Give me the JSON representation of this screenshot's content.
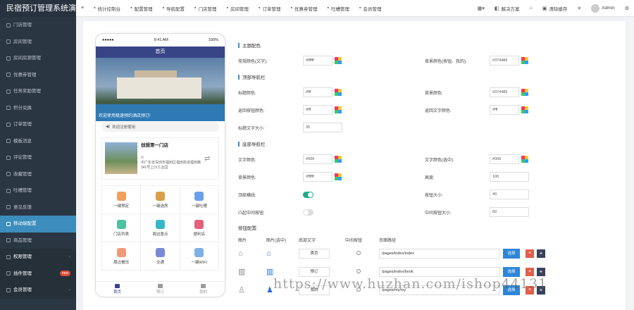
{
  "brand": "民宿预订管理系统演",
  "sidebar": {
    "items": [
      {
        "label": "门店管理",
        "icon": "building-icon"
      },
      {
        "label": "房间管理",
        "icon": "bed-icon"
      },
      {
        "label": "房间房源管理",
        "icon": "home-icon"
      },
      {
        "label": "优惠券管理",
        "icon": "ticket-icon"
      },
      {
        "label": "任务奖励管理",
        "icon": "gift-icon"
      },
      {
        "label": "积分兑换",
        "icon": "coins-icon"
      },
      {
        "label": "订单管理",
        "icon": "list-icon"
      },
      {
        "label": "模板消息",
        "icon": "message-icon"
      },
      {
        "label": "评论管理",
        "icon": "comment-icon"
      },
      {
        "label": "收藏管理",
        "icon": "heart-icon"
      },
      {
        "label": "吐槽管理",
        "icon": "chat-icon"
      },
      {
        "label": "意见反馈",
        "icon": "feedback-icon"
      },
      {
        "label": "移动端配置",
        "icon": "mobile-icon",
        "active": true
      },
      {
        "label": "商品管理",
        "icon": "goods-icon"
      },
      {
        "label": "权限管理",
        "icon": "lock-icon",
        "group": true
      },
      {
        "label": "插件管理",
        "icon": "plugin-icon",
        "group": true,
        "badge": "new"
      },
      {
        "label": "会员管理",
        "icon": "user-icon",
        "group": true
      }
    ]
  },
  "topnav": [
    {
      "label": "统计控制台",
      "icon": "chart-icon"
    },
    {
      "label": "配置管理",
      "icon": "gear-icon"
    },
    {
      "label": "导航配置",
      "icon": "nav-icon"
    },
    {
      "label": "门店管理",
      "icon": "store-icon"
    },
    {
      "label": "房间管理",
      "icon": "bed-icon"
    },
    {
      "label": "订单管理",
      "icon": "list-icon"
    },
    {
      "label": "优惠券管理",
      "icon": "ticket-icon"
    },
    {
      "label": "吐槽管理",
      "icon": "chat-icon"
    },
    {
      "label": "会员管理",
      "icon": "user-icon"
    }
  ],
  "topright": {
    "solution": "解决方案",
    "clear_cache": "清除缓存",
    "user": "Admin"
  },
  "phone": {
    "status_left": "●●●●●",
    "time": "9:41 AM",
    "battery": "100%",
    "title": "首页",
    "banner_caption": "欢迎使用极速预约酒店预订!",
    "notice": "欢迎注册使用",
    "store": {
      "name": "创想第一门店",
      "address": "中广东省深圳市福田区福田街道福田路341号上沙工业园"
    },
    "grid": [
      {
        "label": "一键预定",
        "color": "#f0a05a"
      },
      {
        "label": "一键选房",
        "color": "#d9a04a"
      },
      {
        "label": "一键吐槽",
        "color": "#6aa0e8"
      },
      {
        "label": "门店列表",
        "color": "#4bc2a0"
      },
      {
        "label": "周边景点",
        "color": "#38b6c8"
      },
      {
        "label": "便利店",
        "color": "#e4607a"
      },
      {
        "label": "周边餐饮",
        "color": "#f09a7a"
      },
      {
        "label": "交通",
        "color": "#7a8ad8"
      },
      {
        "label": "一键WIFI",
        "color": "#7fb0e8"
      }
    ],
    "tabs": [
      "首页",
      "预订",
      "我的"
    ]
  },
  "settings": {
    "theme": {
      "title": "主题配色",
      "font_color_label": "常规颜色(文字):",
      "font_color": "#ffffff",
      "bg_color_label": "背景颜色(按钮、我的):",
      "bg_color": "#374486"
    },
    "topnav": {
      "title": "顶部导航栏",
      "title_color_label": "标题颜色:",
      "title_color": "#fff",
      "bg_label": "背景颜色:",
      "bg": "#374486",
      "back_color_label": "返回按钮颜色:",
      "back_color": "#fff",
      "back_text_label": "返回文字颜色:",
      "back_text": "#fff",
      "font_size_label": "标题文字大小:",
      "font_size": "35"
    },
    "bottomnav": {
      "title": "底部导航栏",
      "text_color_label": "文字颜色:",
      "text_color": "#999",
      "text_sel_label": "文字颜色(选中):",
      "text_sel": "#000",
      "bg_label": "背景颜色:",
      "bg": "#ffffff",
      "height_label": "高度:",
      "height": "100",
      "border_label": "顶部横线:",
      "icon_size_label": "按钮大小:",
      "icon_size": "40",
      "convex_label": "凸起中间按钮:",
      "mid_size_label": "中间按钮大小:",
      "mid_size": "60"
    },
    "buttons": {
      "title": "按钮配置:",
      "headers": [
        "图片",
        "图片(选中)",
        "底部文字",
        "中间按钮",
        "页面路径"
      ],
      "select": "选择",
      "rows": [
        {
          "text": "首页",
          "path": "/pages/index/index"
        },
        {
          "text": "预订",
          "path": "/pages/index/book"
        },
        {
          "text": "我的",
          "path": "/pages/my/my"
        }
      ]
    }
  },
  "watermark": "https://www.huzhan.com/ishop44131"
}
